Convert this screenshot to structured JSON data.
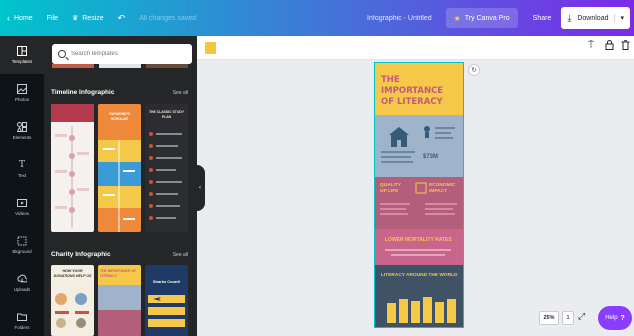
{
  "topbar": {
    "home": "Home",
    "file": "File",
    "resize": "Resize",
    "saved_status": "All changes saved",
    "doc_title": "Infographic - Untitled",
    "try_pro": "Try Canva Pro",
    "share": "Share",
    "download": "Download"
  },
  "rail": [
    {
      "label": "Templates",
      "icon": "templates-icon"
    },
    {
      "label": "Photos",
      "icon": "photos-icon"
    },
    {
      "label": "Elements",
      "icon": "elements-icon"
    },
    {
      "label": "Text",
      "icon": "text-icon"
    },
    {
      "label": "Videos",
      "icon": "videos-icon"
    },
    {
      "label": "Bkground",
      "icon": "background-icon"
    },
    {
      "label": "Uploads",
      "icon": "uploads-icon"
    },
    {
      "label": "Folders",
      "icon": "folders-icon"
    }
  ],
  "panel": {
    "search_placeholder": "Search templates",
    "section1": {
      "title": "Timeline Infographic",
      "see_all": "See all"
    },
    "section2": {
      "title": "Charity Infographic",
      "see_all": "See all"
    },
    "thumb_texts": {
      "timeline_orange": "RAYMOND'S SCHOLAR",
      "timeline_dark": "THE CLASSIC STUDY PLAN",
      "charity_white": "HOW YOUR DONATIONS HELP US",
      "charity_yellow": "THE IMPORTANCE OF LITERACY",
      "charity_navy": "Sharks Count!"
    }
  },
  "canvas": {
    "zoom": "25%",
    "page_count": "1",
    "help": "Help",
    "help_q": "?"
  },
  "poster": {
    "title_line1": "THE IMPORTANCE",
    "title_line2": "OF LITERACY",
    "money": "$73M",
    "quality": "QUALITY OF LIFE",
    "economic": "ECONOMIC IMPACT",
    "mortality": "LOWER MORTALITY RATES",
    "around_world": "LITERACY AROUND THE WORLD"
  }
}
